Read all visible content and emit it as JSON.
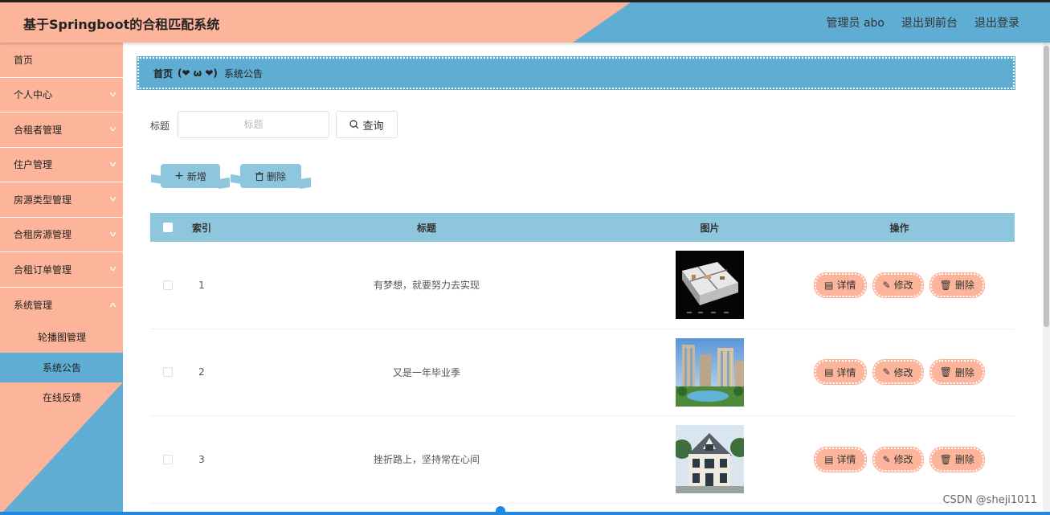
{
  "header": {
    "title": "基于Springboot的合租匹配系统",
    "admin": "管理员 abo",
    "to_front": "退出到前台",
    "logout": "退出登录"
  },
  "sidebar": {
    "items": [
      {
        "label": "首页"
      },
      {
        "label": "个人中心"
      },
      {
        "label": "合租者管理"
      },
      {
        "label": "住户管理"
      },
      {
        "label": "房源类型管理"
      },
      {
        "label": "合租房源管理"
      },
      {
        "label": "合租订单管理"
      },
      {
        "label": "系统管理"
      }
    ],
    "sub_items": [
      {
        "label": "轮播图管理"
      },
      {
        "label": "系统公告"
      },
      {
        "label": "在线反馈"
      }
    ]
  },
  "breadcrumb": {
    "home": "首页",
    "sep": "(❤ ω ❤)",
    "current": "系统公告"
  },
  "search": {
    "label": "标题",
    "placeholder": "标题",
    "button": "查询"
  },
  "actions": {
    "add": "新增",
    "delete": "删除"
  },
  "table": {
    "headers": {
      "index": "索引",
      "title": "标题",
      "image": "图片",
      "ops": "操作"
    },
    "rows": [
      {
        "index": "1",
        "title": "有梦想，就要努力去实现"
      },
      {
        "index": "2",
        "title": "又是一年毕业季"
      },
      {
        "index": "3",
        "title": "挫折路上，坚持常在心间"
      }
    ],
    "op_labels": {
      "detail": "详情",
      "edit": "修改",
      "delete": "删除"
    }
  },
  "watermark": "CSDN @sheji1011",
  "colors": {
    "accent_peach": "#fcb59a",
    "accent_blue": "#5fadd3",
    "table_header": "#8ec6de"
  }
}
